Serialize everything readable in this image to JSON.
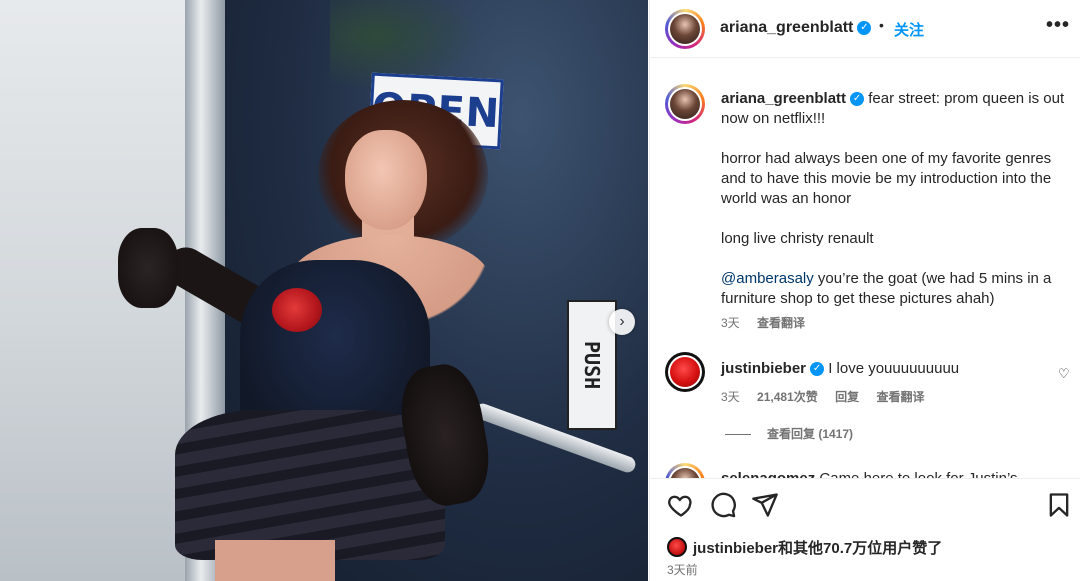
{
  "photo": {
    "sign_open": "OPEN",
    "sign_push": "PUSH",
    "next_icon": "chevron-right-icon"
  },
  "header": {
    "username": "ariana_greenblatt",
    "dot": "•",
    "follow_label": "关注",
    "more_icon": "more-horizontal-icon"
  },
  "caption": {
    "username": "ariana_greenblatt",
    "line1": "fear street: prom queen is out now on netflix!!!",
    "paragraph2": "horror had always been one of my favorite genres and to have this movie be my introduction into the world was an honor",
    "paragraph3": "long live christy renault",
    "mention": "@amberasaly",
    "paragraph4_rest": " you’re the goat (we had 5 mins in a furniture shop to get these pictures ahah)",
    "time": "3天",
    "translate_label": "查看翻译"
  },
  "comment": {
    "username": "justinbieber",
    "text": "I love youuuuuuuuu",
    "time": "3天",
    "likes": "21,481次赞",
    "reply_label": "回复",
    "translate_label": "查看翻译",
    "view_replies": "查看回复 (1417)"
  },
  "partial_comment": {
    "username": "selenagomez",
    "text": "Came here to look for Justin’s"
  },
  "actions": {
    "liked_by_user": "justinbieber",
    "liked_by_rest": "和其他70.7万位用户赞了",
    "post_time": "3天前"
  },
  "colors": {
    "accent": "#0095f6",
    "text": "#262626",
    "secondary": "#737373",
    "mention": "#00376b"
  }
}
